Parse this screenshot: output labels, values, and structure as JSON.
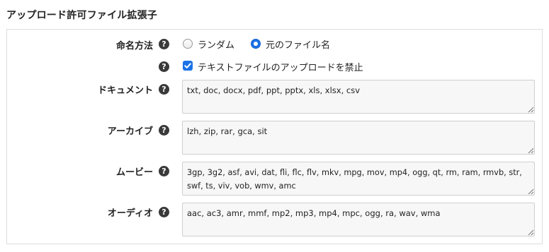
{
  "section": {
    "title": "アップロード許可ファイル拡張子"
  },
  "naming": {
    "label": "命名方法",
    "help_glyph": "?",
    "options": [
      {
        "label": "ランダム",
        "selected": false
      },
      {
        "label": "元のファイル名",
        "selected": true
      }
    ]
  },
  "prohibit_text": {
    "help_glyph": "?",
    "label": "テキストファイルのアップロードを禁止",
    "checked": true
  },
  "fields": {
    "document": {
      "label": "ドキュメント",
      "help_glyph": "?",
      "value": "txt, doc, docx, pdf, ppt, pptx, xls, xlsx, csv"
    },
    "archive": {
      "label": "アーカイブ",
      "help_glyph": "?",
      "value": "lzh, zip, rar, gca, sit"
    },
    "movie": {
      "label": "ムービー",
      "help_glyph": "?",
      "value": "3gp, 3g2, asf, avi, dat, fli, flc, flv, mkv, mpg, mov, mp4, ogg, qt, rm, ram, rmvb, str, swf, ts, viv, vob, wmv, amc"
    },
    "audio": {
      "label": "オーディオ",
      "help_glyph": "?",
      "value": "aac, ac3, amr, mmf, mp2, mp3, mp4, mpc, ogg, ra, wav, wma"
    }
  },
  "colors": {
    "accent": "#1a73e8",
    "help_icon_bg": "#3a3a3a",
    "textarea_bg": "#f7f7f7",
    "border": "#dddddd"
  },
  "icons": {
    "help": "question-circle-icon",
    "check": "checkmark-icon",
    "resize": "resize-grip-icon"
  }
}
